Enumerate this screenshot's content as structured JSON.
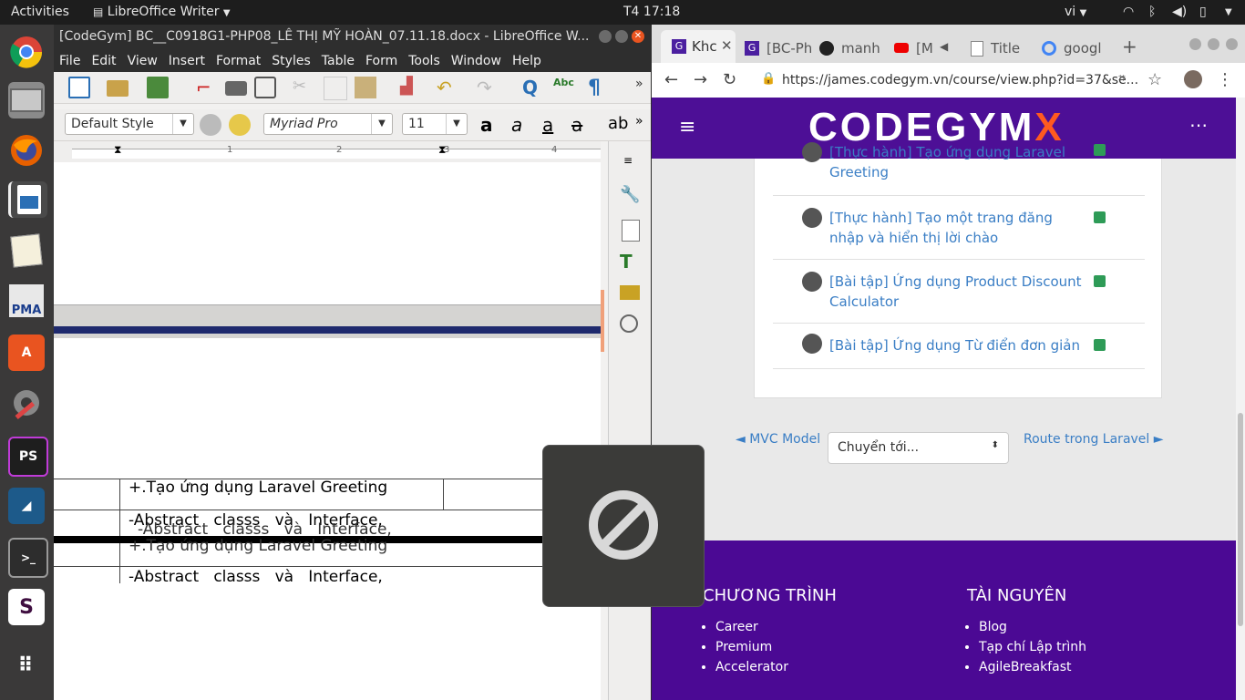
{
  "topbar": {
    "activities": "Activities",
    "app": "LibreOffice Writer",
    "clock": "T4 17:18",
    "lang": "vi"
  },
  "launcher": {
    "items": [
      "chrome",
      "files",
      "firefox",
      "libreoffice-impress",
      "text-editor",
      "phpmyadmin",
      "software-center",
      "settings",
      "phpstorm",
      "mysql-workbench",
      "terminal",
      "slack",
      "app-grid"
    ],
    "pma_label": "PMA",
    "ps_label": "PS"
  },
  "writer": {
    "title": "[CodeGym] BC__C0918G1-PHP08_LÊ THỊ MỸ HOÀN_07.11.18.docx - LibreOffice W...",
    "menu": [
      "File",
      "Edit",
      "View",
      "Insert",
      "Format",
      "Styles",
      "Table",
      "Form",
      "Tools",
      "Window",
      "Help"
    ],
    "style_combo": "Default Style",
    "font_combo": "Myriad Pro",
    "size_combo": "11",
    "ruler_marks": [
      "1",
      "2",
      "3",
      "4"
    ],
    "table": {
      "row1": "+.Tạo ứng dụng Laravel Greeting",
      "row2": "-Abstract   classs   và   Interface,",
      "ghost_row1": "-Abstract   classs   và   Interface,",
      "ghost_row2": "+.Tạo ứng dụng Laravel Greeting",
      "row3": "-Abstract   classs   và   Interface,"
    }
  },
  "chrome": {
    "tabs": [
      {
        "label": "Khc",
        "icon": "G"
      },
      {
        "label": "[BC-Ph",
        "icon": "G"
      },
      {
        "label": "manh",
        "icon": "github"
      },
      {
        "label": "[M",
        "icon": "youtube"
      },
      {
        "label": "Title",
        "icon": "page"
      },
      {
        "label": "googl",
        "icon": "google"
      }
    ],
    "url": "https://james.codegym.vn/course/view.php?id=37&se...",
    "logo": "CODEGYM",
    "logo_x": "X",
    "items": [
      {
        "label": "[Thực hành] Tạo ứng dụng Laravel Greeting"
      },
      {
        "label": "[Thực hành] Tạo một trang đăng nhập và hiển thị lời chào"
      },
      {
        "label": "[Bài tập] Ứng dụng Product Discount Calculator"
      },
      {
        "label": "[Bài tập] Ứng dụng Từ điển đơn giản"
      }
    ],
    "prev_link": "◄ MVC Model",
    "jump_select": "Chuyển tới...",
    "next_link": "Route trong Laravel ►",
    "footer": {
      "col1_title": "CHƯƠNG TRÌNH",
      "col1_items": [
        "Career",
        "Premium",
        "Accelerator"
      ],
      "col2_title": "TÀI NGUYÊN",
      "col2_items": [
        "Blog",
        "Tạp chí Lập trình",
        "AgileBreakfast"
      ]
    }
  }
}
